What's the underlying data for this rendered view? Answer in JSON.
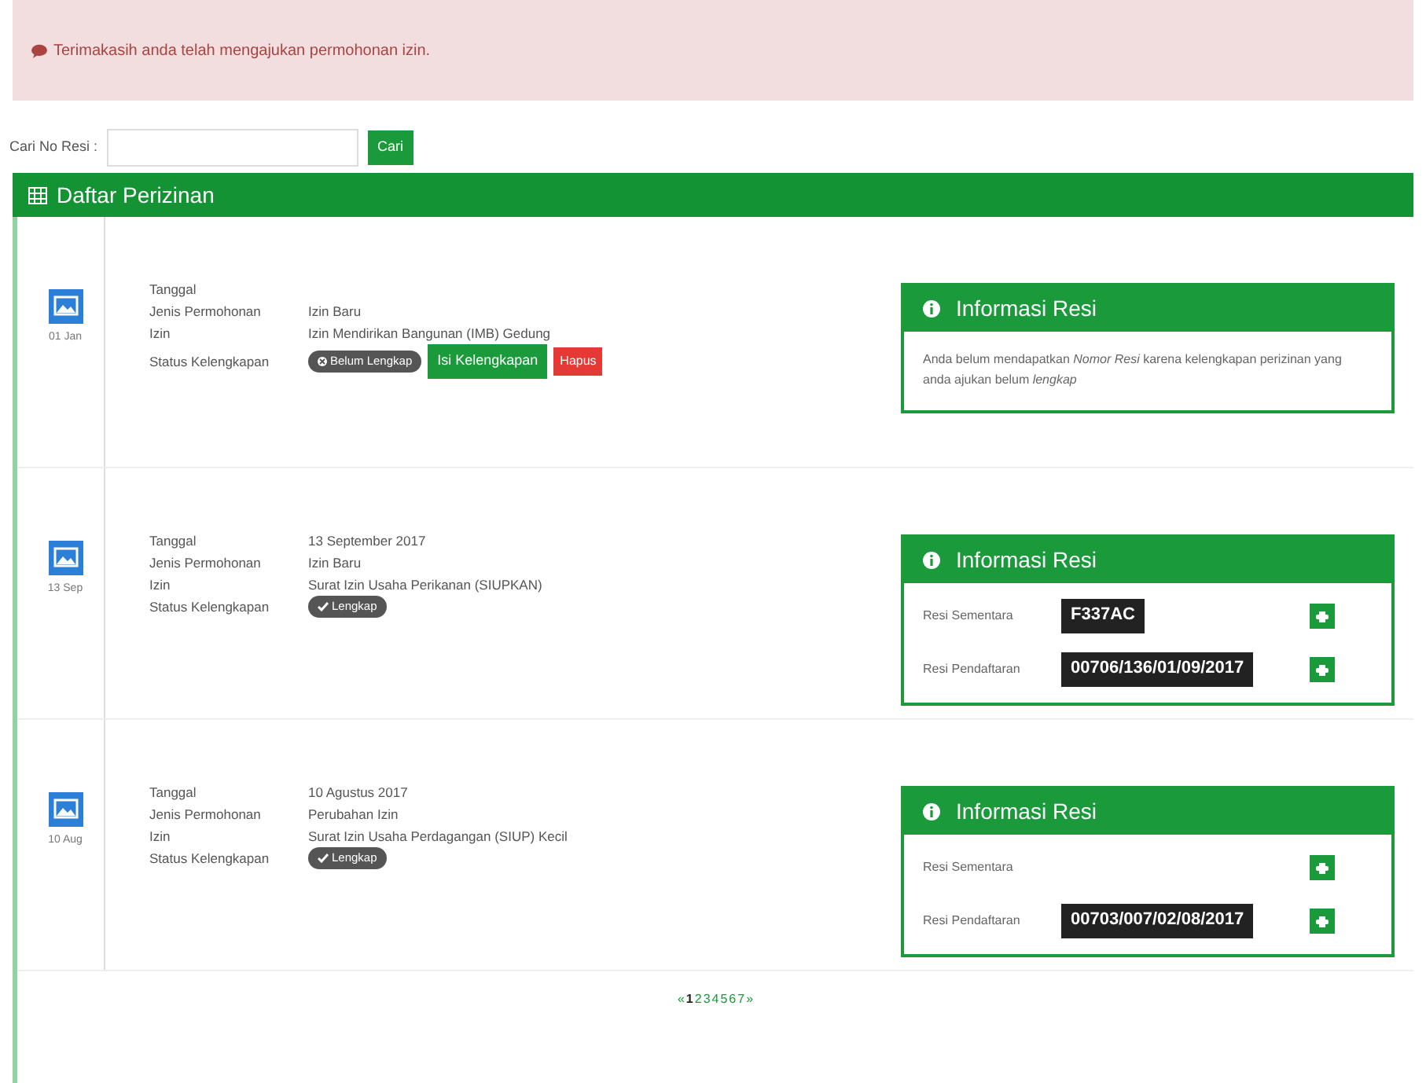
{
  "alert": {
    "text": "Terimakasih anda telah mengajukan permohonan izin."
  },
  "search": {
    "label": "Cari No Resi :",
    "button": "Cari"
  },
  "panel": {
    "title": "Daftar Perizinan"
  },
  "items": [
    {
      "date_badge": "01 Jan",
      "fields": [
        {
          "label": "Tanggal"
        },
        {
          "label": "Jenis Permohonan",
          "value": "Izin Baru"
        },
        {
          "label": "Izin",
          "value": "Izin Mendirikan Bangunan (IMB) Gedung"
        }
      ],
      "status_label": "Status Kelengkapan",
      "status": {
        "text": "Belum Lengkap",
        "complete": false
      },
      "actions": [
        {
          "text": "Isi Kelengkapan",
          "kind": "fill"
        },
        {
          "text": "Hapus",
          "kind": "delete"
        }
      ],
      "info": {
        "title": "Informasi Resi",
        "kind": "message",
        "message": "Anda belum mendapatkan *Nomor Resi* karena kelengkapan perizinan yang anda ajukan belum *lengkap*"
      }
    },
    {
      "date_badge": "13 Sep",
      "fields": [
        {
          "label": "Tanggal",
          "value": "13 September 2017"
        },
        {
          "label": "Jenis Permohonan",
          "value": "Izin Baru"
        },
        {
          "label": "Izin",
          "value": "Surat Izin Usaha Perikanan (SIUPKAN)"
        }
      ],
      "status_label": "Status Kelengkapan",
      "status": {
        "text": "Lengkap",
        "complete": true
      },
      "info": {
        "title": "Informasi Resi",
        "kind": "receipts",
        "receipts": [
          {
            "label": "Resi Sementara",
            "number": "F337AC"
          },
          {
            "label": "Resi Pendaftaran",
            "number": "00706/136/01/09/2017"
          }
        ]
      }
    },
    {
      "date_badge": "10 Aug",
      "fields": [
        {
          "label": "Tanggal",
          "value": "10 Agustus 2017"
        },
        {
          "label": "Jenis Permohonan",
          "value": "Perubahan Izin"
        },
        {
          "label": "Izin",
          "value": "Surat Izin Usaha Perdagangan (SIUP) Kecil"
        }
      ],
      "status_label": "Status Kelengkapan",
      "status": {
        "text": "Lengkap",
        "complete": true
      },
      "info": {
        "title": "Informasi Resi",
        "kind": "receipts",
        "receipts": [
          {
            "label": "Resi Sementara"
          },
          {
            "label": "Resi Pendaftaran",
            "number": "00703/007/02/08/2017"
          }
        ]
      }
    }
  ],
  "pagination": [
    {
      "text": "«",
      "selected": false
    },
    {
      "text": "1",
      "selected": true
    },
    {
      "text": "2",
      "selected": false
    },
    {
      "text": "3",
      "selected": false
    },
    {
      "text": "4",
      "selected": false
    },
    {
      "text": "5",
      "selected": false
    },
    {
      "text": "6",
      "selected": false
    },
    {
      "text": "7",
      "selected": false
    },
    {
      "text": "»",
      "selected": false
    }
  ]
}
